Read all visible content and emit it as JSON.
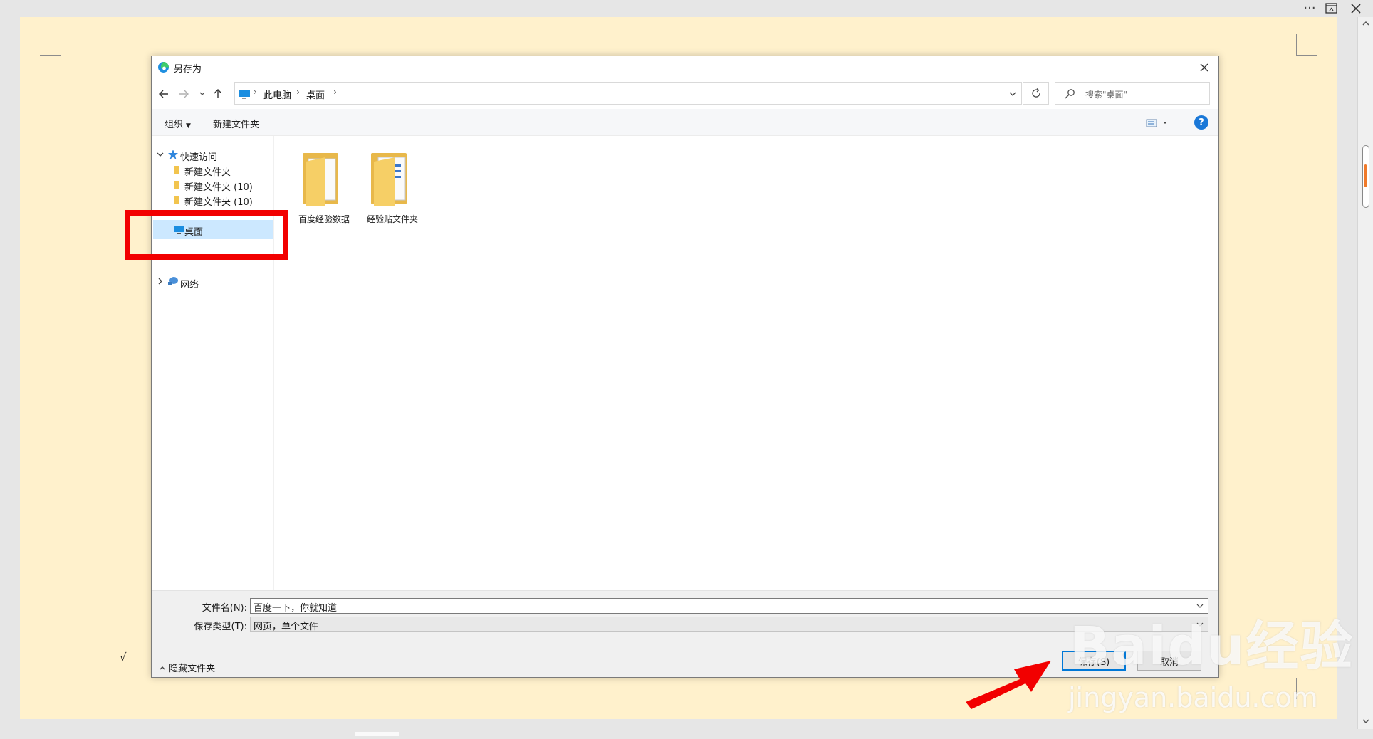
{
  "dialog": {
    "title": "另存为",
    "breadcrumb": [
      "此电脑",
      "桌面"
    ],
    "search_placeholder": "搜索\"桌面\"",
    "toolbar": {
      "organize": "组织",
      "new_folder": "新建文件夹"
    },
    "help": "?",
    "tree": {
      "quick_access": "快速访问",
      "items": [
        "新建文件夹",
        "新建文件夹 (10)",
        "新建文件夹 (10)"
      ],
      "desktop": "桌面",
      "network": "网络"
    },
    "files": [
      {
        "name": "百度经验数据"
      },
      {
        "name": "经验贴文件夹"
      }
    ],
    "bottom": {
      "filename_label": "文件名(N):",
      "filename_value": "百度一下，你就知道",
      "filetype_label": "保存类型(T):",
      "filetype_value": "网页，单个文件",
      "hide_folders": "隐藏文件夹",
      "save": "保存(S)",
      "cancel": "取消"
    }
  },
  "window": {
    "more": "···"
  },
  "page": {
    "checkmark": "√"
  },
  "watermark": {
    "logo": "Baidu经验",
    "domain": "jingyan.baidu.com"
  },
  "colors": {
    "accent": "#0078d7",
    "selection": "#cce8ff",
    "highlight_box": "#f20000",
    "page_bg": "#fff1cc"
  }
}
